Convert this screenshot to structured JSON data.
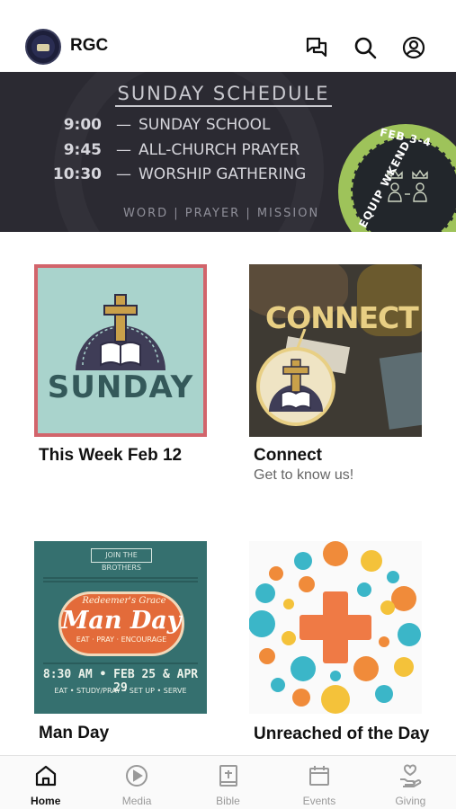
{
  "header": {
    "app_title": "RGC"
  },
  "banner": {
    "title": "SUNDAY SCHEDULE",
    "schedule": [
      {
        "time": "9:00",
        "event": "SUNDAY SCHOOL"
      },
      {
        "time": "9:45",
        "event": "ALL-CHURCH PRAYER"
      },
      {
        "time": "10:30",
        "event": "WORSHIP GATHERING"
      }
    ],
    "footer": "WORD | PRAYER | MISSION",
    "badge_date": "FEB 3-4",
    "badge_text": "EQUIP WKEND"
  },
  "tiles": [
    {
      "title": "This Week Feb 12",
      "subtitle": "",
      "image_text": "SUNDAY"
    },
    {
      "title": "Connect",
      "subtitle": "Get to know us!",
      "image_text": "CONNECT"
    },
    {
      "title": "Man Day",
      "subtitle": "",
      "image": {
        "top": "JOIN THE BROTHERS",
        "sub": "Redeemer's Grace",
        "main": "Man Day",
        "tag": "EAT · PRAY · ENCOURAGE",
        "dates": "8:30 AM • FEB 25 & APR 29",
        "foot": "EAT • STUDY/PRAY • SET UP • SERVE"
      }
    },
    {
      "title": "Unreached of the Day",
      "subtitle": ""
    }
  ],
  "nav": [
    {
      "label": "Home",
      "icon": "home-icon",
      "active": true
    },
    {
      "label": "Media",
      "icon": "play-icon",
      "active": false
    },
    {
      "label": "Bible",
      "icon": "bible-icon",
      "active": false
    },
    {
      "label": "Events",
      "icon": "calendar-icon",
      "active": false
    },
    {
      "label": "Giving",
      "icon": "giving-icon",
      "active": false
    }
  ],
  "colors": {
    "banner_bg": "#2b2a32",
    "sunday_bg": "#a9d3cc",
    "sunday_border": "#d2646b",
    "manday_bg": "#35706f",
    "accent_orange": "#e36b3a"
  }
}
